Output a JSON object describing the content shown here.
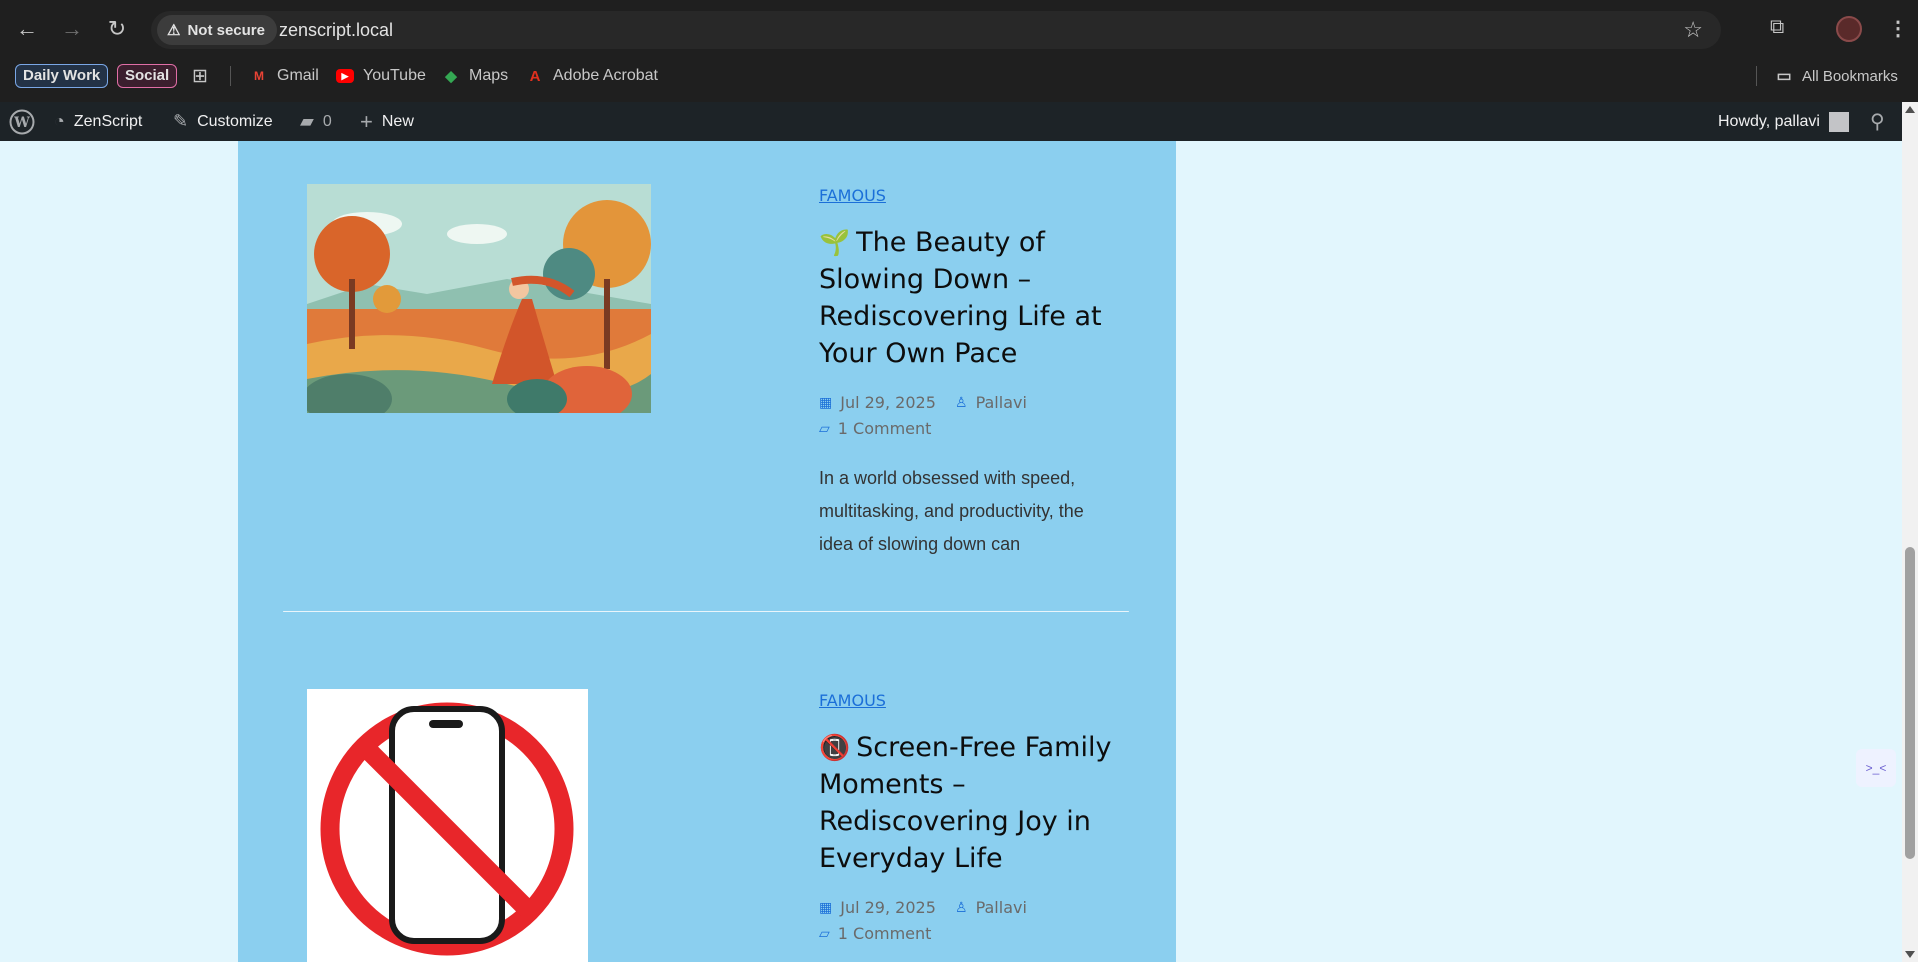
{
  "browser": {
    "security_label": "Not secure",
    "url": "zenscript.local",
    "bookmark_chips": [
      {
        "label": "Daily Work",
        "color": "#7aa7e6"
      },
      {
        "label": "Social",
        "color": "#e06ea6"
      }
    ],
    "bookmarks": [
      {
        "label": "Gmail",
        "icon": "gmail-icon"
      },
      {
        "label": "YouTube",
        "icon": "youtube-icon"
      },
      {
        "label": "Maps",
        "icon": "maps-icon"
      },
      {
        "label": "Adobe Acrobat",
        "icon": "acrobat-icon"
      }
    ],
    "all_bookmarks_label": "All Bookmarks"
  },
  "admin_bar": {
    "site_name": "ZenScript",
    "customize_label": "Customize",
    "comments_count": "0",
    "new_label": "New",
    "greeting": "Howdy, pallavi"
  },
  "posts": [
    {
      "category": "FAMOUS",
      "emoji": "🌱",
      "title": "The Beauty of Slowing Down – Rediscovering Life at Your Own Pace",
      "date": "Jul 29, 2025",
      "author": "Pallavi",
      "comments": "1 Comment",
      "excerpt": "In a world obsessed with speed, multitasking, and productivity, the idea of slowing down can"
    },
    {
      "category": "FAMOUS",
      "emoji": "📵",
      "title": "Screen-Free Family Moments – Rediscovering Joy in Everyday Life",
      "date": "Jul 29, 2025",
      "author": "Pallavi",
      "comments": "1 Comment"
    }
  ],
  "widget": {
    "label": ">_<"
  },
  "colors": {
    "accent": "#1b6fd8",
    "panel": "#8bcfef",
    "page_bg": "#e2f6fd",
    "admin_bar": "#1d2327"
  }
}
